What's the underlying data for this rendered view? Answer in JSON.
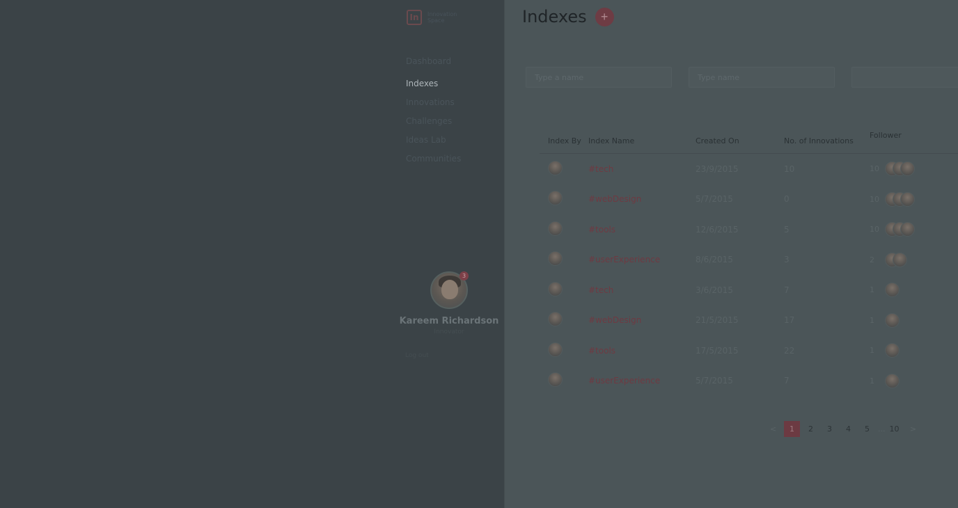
{
  "brand": {
    "logo": "In",
    "line1": "Innovation",
    "line2": "Space"
  },
  "nav": {
    "items": [
      {
        "label": "Dashboard"
      },
      {
        "label": "Indexes",
        "active": true
      },
      {
        "label": "Innovations"
      },
      {
        "label": "Challenges"
      },
      {
        "label": "Ideas Lab"
      },
      {
        "label": "Communities"
      }
    ]
  },
  "profile": {
    "name": "Kareem Richardson",
    "subtitle": "Innovator",
    "badge": "3",
    "link": "Log out"
  },
  "header": {
    "title": "Indexes",
    "add_label": "+"
  },
  "filters": {
    "name_placeholder": "Type a name",
    "index_placeholder": "Type name",
    "third_placeholder": ""
  },
  "table": {
    "headers": {
      "index_by": "Index By",
      "index_name": "Index Name",
      "created_on": "Created On",
      "innovations": "No. of Innovations",
      "follower": "Follower"
    },
    "rows": [
      {
        "name": "#tech",
        "created": "23/9/2015",
        "innovations": "10",
        "followers": "10",
        "avatars": 3
      },
      {
        "name": "#webDesign",
        "created": "5/7/2015",
        "innovations": "0",
        "followers": "10",
        "avatars": 3
      },
      {
        "name": "#tools",
        "created": "12/6/2015",
        "innovations": "5",
        "followers": "10",
        "avatars": 3
      },
      {
        "name": "#userExperience",
        "created": "8/6/2015",
        "innovations": "3",
        "followers": "2",
        "avatars": 2
      },
      {
        "name": "#tech",
        "created": "3/6/2015",
        "innovations": "7",
        "followers": "1",
        "avatars": 1
      },
      {
        "name": "#webDesign",
        "created": "21/5/2015",
        "innovations": "17",
        "followers": "1",
        "avatars": 1
      },
      {
        "name": "#tools",
        "created": "17/5/2015",
        "innovations": "22",
        "followers": "1",
        "avatars": 1
      },
      {
        "name": "#userExperience",
        "created": "5/7/2015",
        "innovations": "7",
        "followers": "1",
        "avatars": 1
      }
    ]
  },
  "pagination": {
    "prev": "<",
    "pages": [
      "1",
      "2",
      "3",
      "4",
      "5"
    ],
    "ellipsis": "...",
    "last": "10",
    "next": ">",
    "current": "1"
  },
  "colors": {
    "accent": "#6e3c44",
    "overlay_panel": "#3b4347",
    "main_bg": "#4b5558"
  }
}
